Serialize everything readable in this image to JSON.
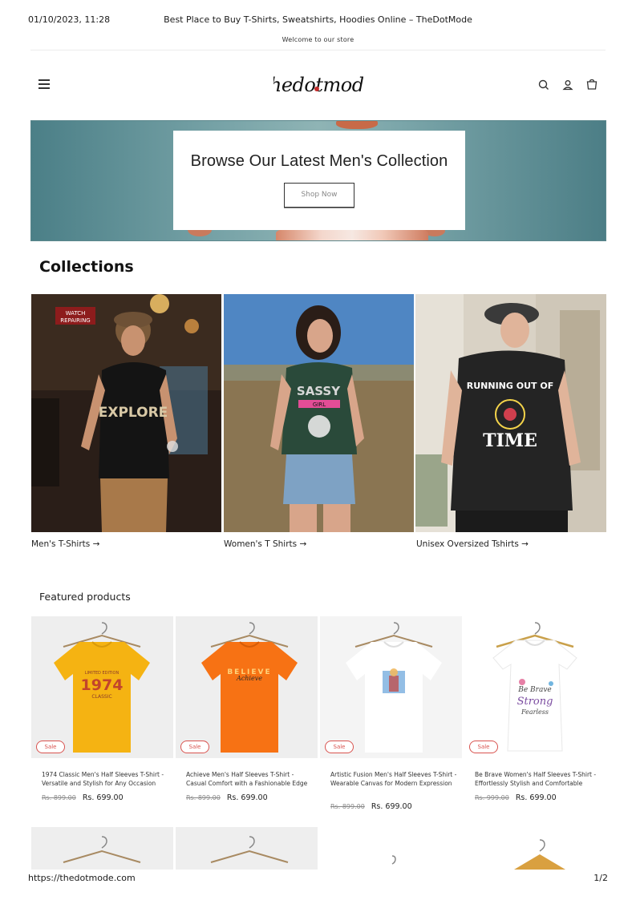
{
  "print": {
    "datetime": "01/10/2023, 11:28",
    "title": "Best Place to Buy T-Shirts, Sweatshirts, Hoodies Online – TheDotMode",
    "url": "https://thedotmode.com",
    "page": "1/2"
  },
  "announcement": "Welcome to our store",
  "header": {
    "logo_text": "thedotmode",
    "icons": [
      "menu-icon",
      "search-icon",
      "account-icon",
      "cart-icon"
    ]
  },
  "hero": {
    "heading": "Browse Our Latest Men's Collection",
    "button_label": "Shop Now"
  },
  "collections": {
    "title": "Collections",
    "items": [
      {
        "label": "Men's T-Shirts →",
        "shirt_text": "EXPLORE"
      },
      {
        "label": "Women's T Shirts →",
        "shirt_text": "SASSY GIRL"
      },
      {
        "label": "Unisex Oversized Tshirts →",
        "shirt_text": "RUNNING OUT OF TIME"
      }
    ]
  },
  "featured": {
    "title": "Featured products",
    "sale_label": "Sale",
    "products": [
      {
        "name": "1974 Classic Men's Half Sleeves T-Shirt - Versatile and Stylish for Any Occasion",
        "old_price": "Rs. 899.00",
        "price": "Rs. 699.00",
        "shirt_color": "#f5b312",
        "print_text": "1974"
      },
      {
        "name": "Achieve Men's Half Sleeves T-Shirt - Casual Comfort with a Fashionable Edge",
        "old_price": "Rs. 899.00",
        "price": "Rs. 699.00",
        "shirt_color": "#f77214",
        "print_text": "BELIEVE"
      },
      {
        "name": "Artistic Fusion Men's Half Sleeves T-Shirt - Wearable Canvas for Modern Expression",
        "old_price": "Rs. 899.00",
        "price": "Rs. 699.00",
        "shirt_color": "#fafafa",
        "print_text": ""
      },
      {
        "name": "Be Brave Women's Half Sleeves T-Shirt - Effortlessly Stylish and Comfortable",
        "old_price": "Rs. 999.00",
        "price": "Rs. 699.00",
        "shirt_color": "#fafafa",
        "print_text": "Be Brave"
      }
    ]
  },
  "colors": {
    "accent": "#d9534f",
    "hero": "#6f9da2"
  }
}
